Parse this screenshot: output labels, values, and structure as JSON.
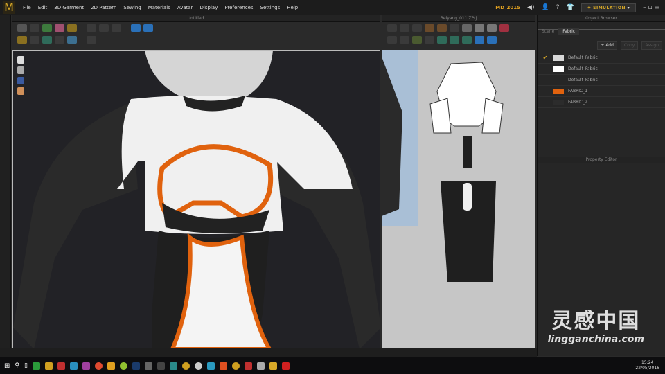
{
  "app": {
    "logo": "M",
    "version": "MD_2015",
    "mode_button": "SIMULATION"
  },
  "menu": [
    "File",
    "Edit",
    "3D Garment",
    "2D Pattern",
    "Sewing",
    "Materials",
    "Avatar",
    "Display",
    "Preferences",
    "Settings",
    "Help"
  ],
  "panels": {
    "viewport_3d_title": "Untitled",
    "viewport_2d_title": "Beiyang_011.ZPrj",
    "object_browser_title": "Object Browser",
    "property_editor_title": "Property Editor"
  },
  "object_browser": {
    "tabs": [
      "Scene",
      "Fabric"
    ],
    "active_tab": "Fabric",
    "buttons": {
      "add": "+ Add",
      "copy": "Copy",
      "assign": "Assign"
    },
    "fabrics": [
      {
        "name": "Default_Fabric",
        "color": "#d8d8d8",
        "checked": true
      },
      {
        "name": "Default_Fabric",
        "color": "#ffffff",
        "checked": false
      },
      {
        "name": "Default_Fabric",
        "color": "",
        "checked": false
      },
      {
        "name": "FABRIC_1",
        "color": "#e0620e",
        "checked": false
      },
      {
        "name": "FABRIC_2",
        "color": "#2c2c2c",
        "checked": false
      }
    ]
  },
  "taskbar": {
    "time": "15:24",
    "date": "22/05/2016"
  },
  "watermark": {
    "cn": "灵感中国",
    "en": "lingganchina.com"
  },
  "colors": {
    "accent": "#d8a928",
    "orange": "#e0620e",
    "garment_white": "#f2f2f2",
    "garment_black": "#1f1f1f"
  }
}
